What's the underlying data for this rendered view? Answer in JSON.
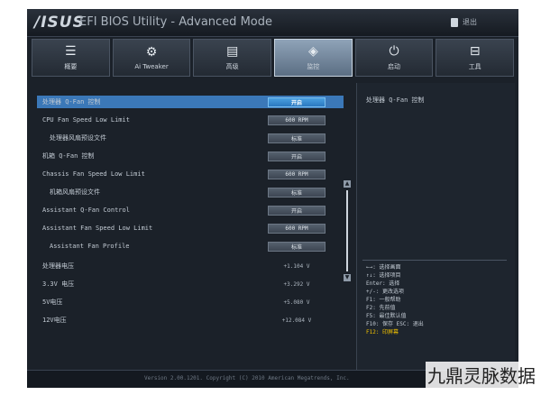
{
  "titlebar": {
    "logo": "/ISUS",
    "title": "EFI BIOS Utility - Advanced Mode",
    "exit_label": "退出"
  },
  "tabs": [
    {
      "icon": "☰",
      "icon_name": "menu-list-icon",
      "label": "概要"
    },
    {
      "icon": "⚙",
      "icon_name": "tweaker-icon",
      "label": "Ai Tweaker"
    },
    {
      "icon": "▤",
      "icon_name": "advanced-icon",
      "label": "高级"
    },
    {
      "icon": "◈",
      "icon_name": "monitor-icon",
      "label": "监控"
    },
    {
      "icon": "⏻",
      "icon_name": "power-icon",
      "label": "启动"
    },
    {
      "icon": "⊟",
      "icon_name": "tool-icon",
      "label": "工具"
    }
  ],
  "settings": [
    {
      "label": "处理器 Q-Fan 控制",
      "value": "开启"
    },
    {
      "label": "CPU Fan Speed Low Limit",
      "value": "600 RPM"
    },
    {
      "label": "处理器风扇预设文件",
      "value": "标准"
    },
    {
      "label": "机箱 Q-Fan 控制",
      "value": "开启"
    },
    {
      "label": "Chassis Fan Speed Low Limit",
      "value": "600 RPM"
    },
    {
      "label": "机箱风扇预设文件",
      "value": "标准"
    },
    {
      "label": "Assistant Q-Fan Control",
      "value": "开启"
    },
    {
      "label": "Assistant Fan Speed Low Limit",
      "value": "600 RPM"
    },
    {
      "label": "Assistant Fan Profile",
      "value": "标准"
    }
  ],
  "voltages": [
    {
      "label": "处理器电压",
      "value": "+1.104 V"
    },
    {
      "label": "3.3V 电压",
      "value": "+3.292 V"
    },
    {
      "label": "5V电压",
      "value": "+5.080 V"
    },
    {
      "label": "12V电压",
      "value": "+12.084 V"
    }
  ],
  "help": {
    "title": "处理器 Q-Fan 控制",
    "keys": [
      "←→: 选择画面",
      "↑↓: 选择项目",
      "Enter: 选择",
      "+/-: 更改选项",
      "F1: 一般帮助",
      "F2: 先前值",
      "F5: 最佳默认值",
      "F10: 保存  ESC: 退出",
      "F12: 印屏幕"
    ]
  },
  "footer": {
    "version": "Version 2.00.1201. Copyright (C) 2010 American Megatrends, Inc."
  },
  "watermark": "九鼎灵脉数据"
}
